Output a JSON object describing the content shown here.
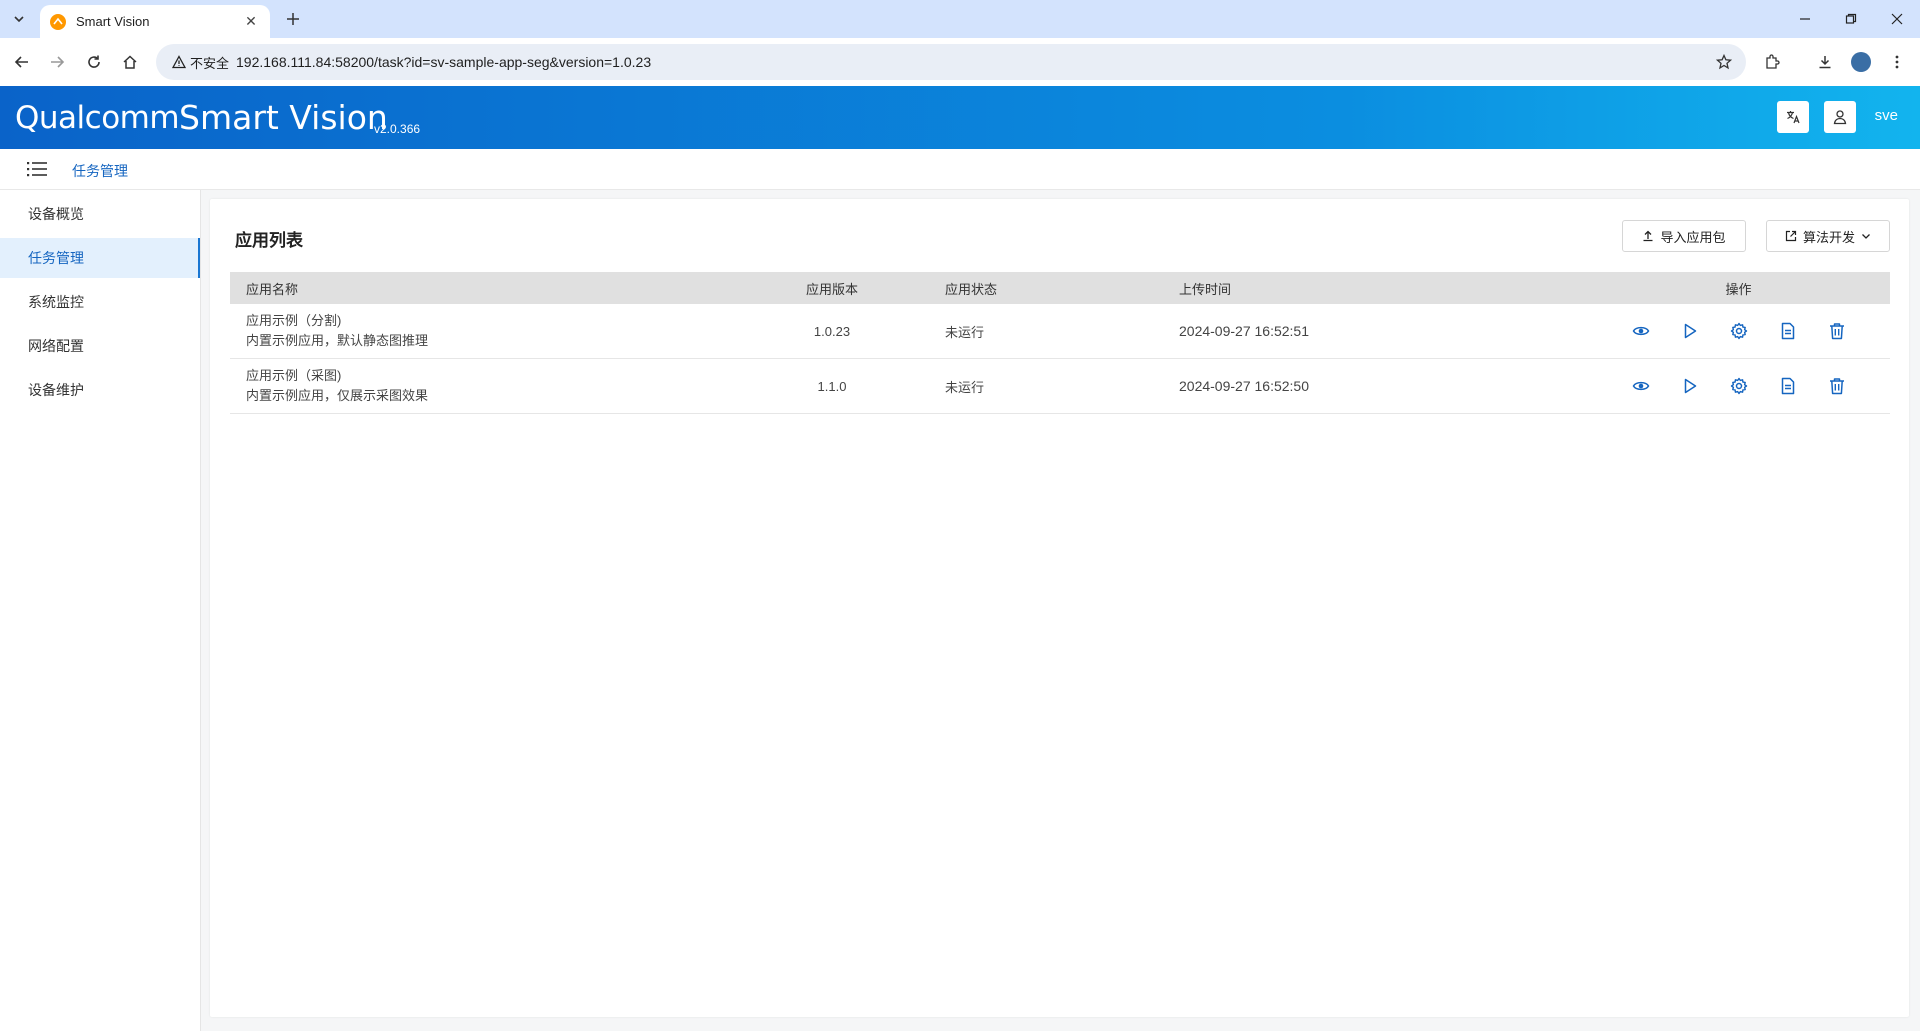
{
  "browser": {
    "tab_title": "Smart Vision",
    "security_label": "不安全",
    "url": "192.168.111.84:58200/task?id=sv-sample-app-seg&version=1.0.23"
  },
  "header": {
    "logo_text": "Qualcomm",
    "app_name": "Smart Vision",
    "version": "v2.0.366",
    "user": "sve",
    "brand_color": "#0b8ee0"
  },
  "breadcrumb": {
    "current": "任务管理"
  },
  "sidebar": {
    "items": [
      {
        "label": "设备概览"
      },
      {
        "label": "任务管理"
      },
      {
        "label": "系统监控"
      },
      {
        "label": "网络配置"
      },
      {
        "label": "设备维护"
      }
    ],
    "active_index": 1
  },
  "main": {
    "title": "应用列表",
    "import_button": "导入应用包",
    "algo_button": "算法开发",
    "columns": {
      "name": "应用名称",
      "version": "应用版本",
      "status": "应用状态",
      "upload_time": "上传时间",
      "actions": "操作"
    },
    "rows": [
      {
        "name": "应用示例（分割)",
        "desc": "内置示例应用，默认静态图推理",
        "version": "1.0.23",
        "status": "未运行",
        "upload_time": "2024-09-27 16:52:51"
      },
      {
        "name": "应用示例（采图)",
        "desc": "内置示例应用，仅展示采图效果",
        "version": "1.1.0",
        "status": "未运行",
        "upload_time": "2024-09-27 16:52:50"
      }
    ],
    "action_icons": [
      "eye-icon",
      "play-icon",
      "gear-icon",
      "document-icon",
      "trash-icon"
    ],
    "action_color": "#1565c0"
  }
}
